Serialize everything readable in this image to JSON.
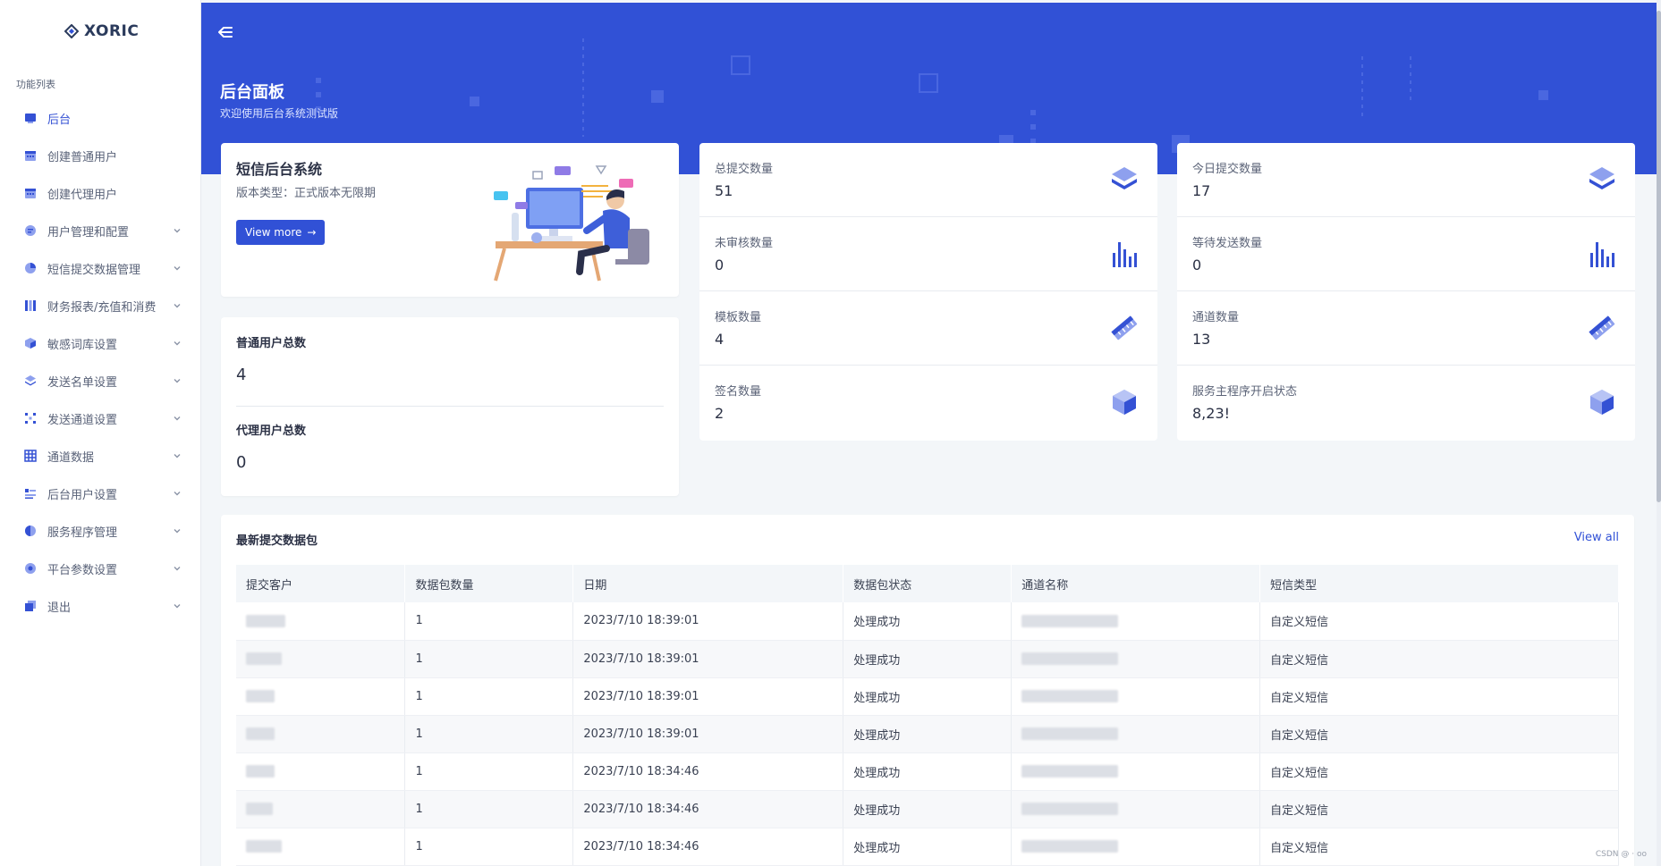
{
  "brand": {
    "name": "XORIC"
  },
  "sidebar": {
    "caption": "功能列表",
    "items": [
      {
        "label": "后台",
        "icon": "dashboard-icon",
        "active": true,
        "has_children": false
      },
      {
        "label": "创建普通用户",
        "icon": "calendar-icon",
        "active": false,
        "has_children": false
      },
      {
        "label": "创建代理用户",
        "icon": "calendar-icon",
        "active": false,
        "has_children": false
      },
      {
        "label": "用户管理和配置",
        "icon": "chat-icon",
        "active": false,
        "has_children": true
      },
      {
        "label": "短信提交数据管理",
        "icon": "chart-pie-icon",
        "active": false,
        "has_children": true
      },
      {
        "label": "财务报表/充值和消费",
        "icon": "columns-icon",
        "active": false,
        "has_children": true
      },
      {
        "label": "敏感词库设置",
        "icon": "cube-icon",
        "active": false,
        "has_children": true
      },
      {
        "label": "发送名单设置",
        "icon": "layers-icon",
        "active": false,
        "has_children": true
      },
      {
        "label": "发送通道设置",
        "icon": "grid-dots-icon",
        "active": false,
        "has_children": true
      },
      {
        "label": "通道数据",
        "icon": "table-icon",
        "active": false,
        "has_children": true
      },
      {
        "label": "后台用户设置",
        "icon": "list-icon",
        "active": false,
        "has_children": true
      },
      {
        "label": "服务程序管理",
        "icon": "pie-icon",
        "active": false,
        "has_children": true
      },
      {
        "label": "平台参数设置",
        "icon": "settings-circle-icon",
        "active": false,
        "has_children": true
      },
      {
        "label": "退出",
        "icon": "copy-icon",
        "active": false,
        "has_children": true
      }
    ]
  },
  "header": {
    "title": "后台面板",
    "subtitle": "欢迎使用后台系统测试版"
  },
  "welcome": {
    "title": "短信后台系统",
    "subtitle": "版本类型：正式版本无限期",
    "button": "View more"
  },
  "users": {
    "normal_label": "普通用户总数",
    "normal_value": "4",
    "agent_label": "代理用户总数",
    "agent_value": "0"
  },
  "stats_left": [
    {
      "label": "总提交数量",
      "value": "51",
      "icon": "layers-icon"
    },
    {
      "label": "未审核数量",
      "value": "0",
      "icon": "bar-chart-icon"
    },
    {
      "label": "模板数量",
      "value": "4",
      "icon": "ruler-icon"
    },
    {
      "label": "签名数量",
      "value": "2",
      "icon": "cube-icon"
    }
  ],
  "stats_right": [
    {
      "label": "今日提交数量",
      "value": "17",
      "icon": "layers-icon"
    },
    {
      "label": "等待发送数量",
      "value": "0",
      "icon": "bar-chart-icon"
    },
    {
      "label": "通道数量",
      "value": "13",
      "icon": "ruler-icon"
    },
    {
      "label": "服务主程序开启状态",
      "value": "8,23!",
      "icon": "cube-icon"
    }
  ],
  "table": {
    "title": "最新提交数据包",
    "view_all": "View all",
    "columns": [
      "提交客户",
      "数据包数量",
      "日期",
      "数据包状态",
      "通道名称",
      "短信类型"
    ],
    "rows": [
      {
        "count": "1",
        "date": "2023/7/10 18:39:01",
        "status": "处理成功",
        "type": "自定义短信"
      },
      {
        "count": "1",
        "date": "2023/7/10 18:39:01",
        "status": "处理成功",
        "type": "自定义短信"
      },
      {
        "count": "1",
        "date": "2023/7/10 18:39:01",
        "status": "处理成功",
        "type": "自定义短信"
      },
      {
        "count": "1",
        "date": "2023/7/10 18:39:01",
        "status": "处理成功",
        "type": "自定义短信"
      },
      {
        "count": "1",
        "date": "2023/7/10 18:34:46",
        "status": "处理成功",
        "type": "自定义短信"
      },
      {
        "count": "1",
        "date": "2023/7/10 18:34:46",
        "status": "处理成功",
        "type": "自定义短信"
      },
      {
        "count": "1",
        "date": "2023/7/10 18:34:46",
        "status": "处理成功",
        "type": "自定义短信"
      }
    ]
  },
  "watermark": "CSDN @ · oo",
  "colors": {
    "accent": "#3151d6",
    "icon_fill": "#3451d4",
    "icon_light": "#8ea0ee"
  }
}
